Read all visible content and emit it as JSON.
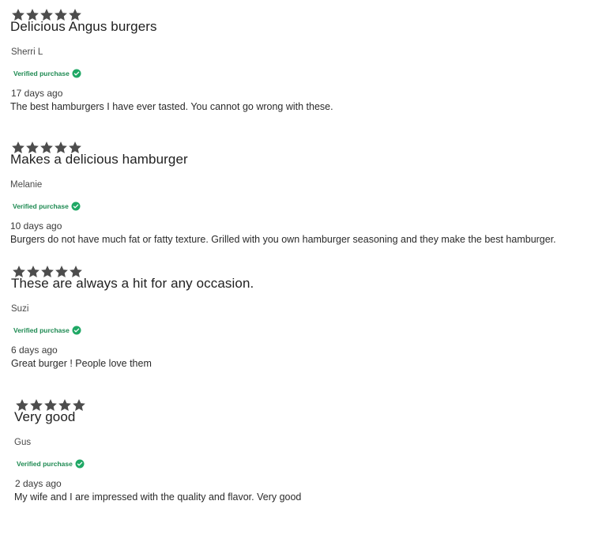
{
  "colors": {
    "star": "#4d4d4d",
    "verified": "#1e8a52",
    "check_badge": "#1fa865"
  },
  "icons": {
    "star": "star-icon",
    "verified": "check-circle-icon"
  },
  "reviews": [
    {
      "rating": 5,
      "title": "Delicious Angus burgers",
      "author": "Sherri L",
      "verified_label": "Verified purchase",
      "age": "17 days ago",
      "body": "The best hamburgers I have ever tasted. You cannot go wrong with these."
    },
    {
      "rating": 5,
      "title": "Makes a delicious hamburger",
      "author": "Melanie",
      "verified_label": "Verified purchase",
      "age": "10 days ago",
      "body": "Burgers do not have much fat or fatty texture. Grilled with you own hamburger seasoning and they make the best hamburger."
    },
    {
      "rating": 5,
      "title": "These are always a hit for any occasion.",
      "author": "Suzi",
      "verified_label": "Verified purchase",
      "age": "6 days ago",
      "body": "Great burger ! People love them"
    },
    {
      "rating": 5,
      "title": "Very good",
      "author": "Gus",
      "verified_label": "Verified purchase",
      "age": "2 days ago",
      "body": "My wife and I are impressed with the quality and flavor. Very good"
    }
  ]
}
